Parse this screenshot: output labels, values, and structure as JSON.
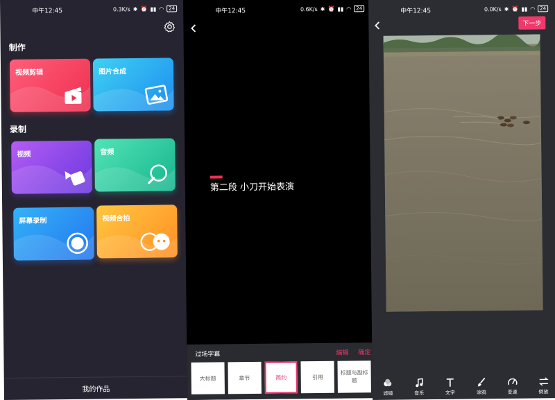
{
  "status": {
    "time": "中午12:45",
    "speed1": "0.3K/s",
    "speed2": "0.6K/s",
    "speed3": "0.0K/s",
    "battery": "24"
  },
  "home": {
    "section_make": "制作",
    "section_record": "录制",
    "cards": {
      "video_edit": "视频剪辑",
      "photo_compose": "图片合成",
      "video": "视频",
      "audio": "音频",
      "screen_record": "屏幕录制",
      "video_duet": "视频合拍"
    },
    "my_works": "我的作品"
  },
  "caption_editor": {
    "subtitle": "第二段 小刀开始表演",
    "panel_title": "过场字幕",
    "edit": "编辑",
    "confirm": "确定",
    "templates": [
      "大标题",
      "章节",
      "简约",
      "引用",
      "标题与副标题"
    ],
    "selected_index": 2
  },
  "video_editor": {
    "next": "下一步",
    "tools": [
      "滤镜",
      "音乐",
      "文字",
      "涂鸦",
      "变速",
      "倒放"
    ]
  },
  "colors": {
    "accent": "#f0386a",
    "home_bg": "#262430",
    "editor_bg": "#2b2d33"
  }
}
